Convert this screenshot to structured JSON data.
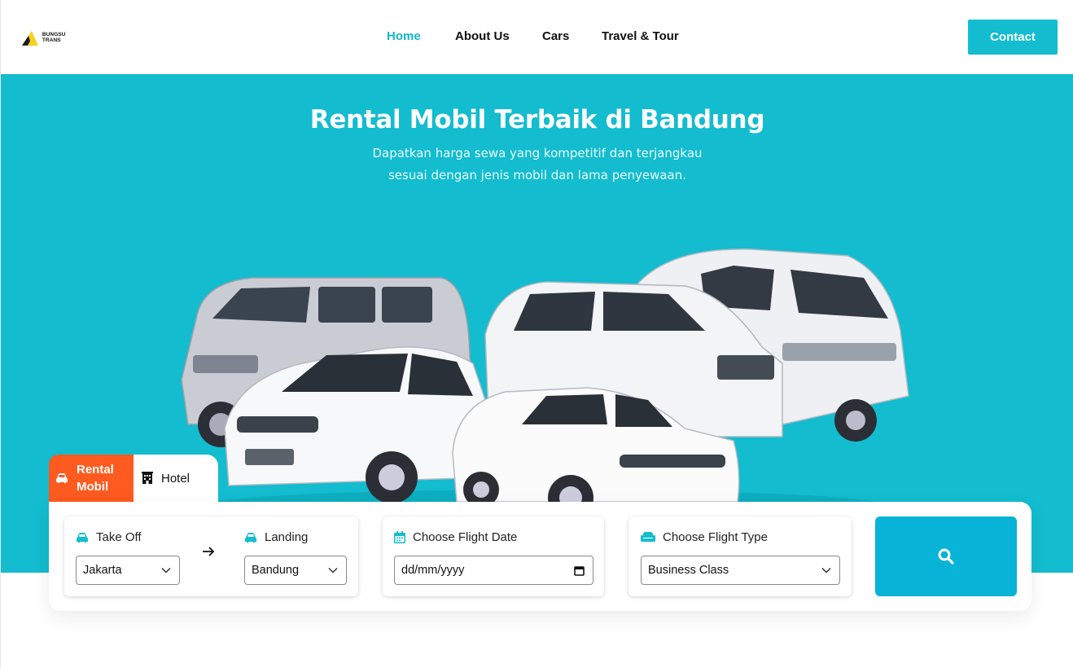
{
  "brand": {
    "logo_text": "BUNGSU TRANS"
  },
  "nav": {
    "items": [
      {
        "label": "Home",
        "active": true
      },
      {
        "label": "About Us",
        "active": false
      },
      {
        "label": "Cars",
        "active": false
      },
      {
        "label": "Travel & Tour",
        "active": false
      }
    ],
    "contact_label": "Contact"
  },
  "hero": {
    "title": "Rental Mobil Terbaik di Bandung",
    "subtitle_line1": "Dapatkan harga sewa yang kompetitif dan terjangkau",
    "subtitle_line2": "sesuai dengan jenis mobil dan lama penyewaan."
  },
  "tabs": {
    "rental_line1": "Rental",
    "rental_line2": "Mobil",
    "hotel": "Hotel"
  },
  "search": {
    "takeoff_label": "Take Off",
    "takeoff_value": "Jakarta",
    "landing_label": "Landing",
    "landing_value": "Bandung",
    "date_label": "Choose Flight Date",
    "date_placeholder": "dd/mm/yyyy",
    "type_label": "Choose Flight Type",
    "type_value": "Business Class"
  },
  "colors": {
    "accent": "#13bccf",
    "active_nav": "#13b5cf",
    "tab_orange": "#ff5a1f",
    "search_button": "#07b3d6"
  },
  "icons": [
    "car-icon",
    "hotel-icon",
    "calendar-icon",
    "seat-icon",
    "search-icon",
    "chevron-down-icon",
    "arrow-right-icon"
  ]
}
